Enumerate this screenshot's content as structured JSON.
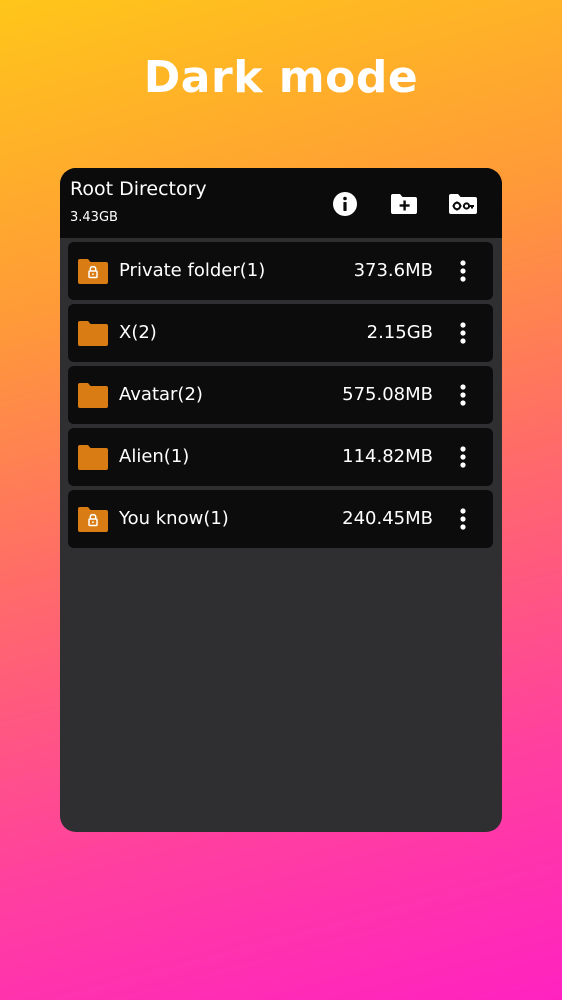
{
  "headline": "Dark mode",
  "appbar": {
    "title": "Root Directory",
    "subtitle": "3.43GB",
    "actions": [
      {
        "icon": "info-icon"
      },
      {
        "icon": "new-folder-icon"
      },
      {
        "icon": "folder-key-icon"
      }
    ]
  },
  "colors": {
    "folder": "#d97c14",
    "card": "#0c0c0d",
    "screen": "#2f2e31",
    "appbar": "#0b0b0c"
  },
  "folders": [
    {
      "name": "Private folder(1)",
      "size": "373.6MB",
      "locked": true
    },
    {
      "name": "X(2)",
      "size": "2.15GB",
      "locked": false
    },
    {
      "name": "Avatar(2)",
      "size": "575.08MB",
      "locked": false
    },
    {
      "name": "Alien(1)",
      "size": "114.82MB",
      "locked": false
    },
    {
      "name": "You know(1)",
      "size": "240.45MB",
      "locked": true
    }
  ]
}
